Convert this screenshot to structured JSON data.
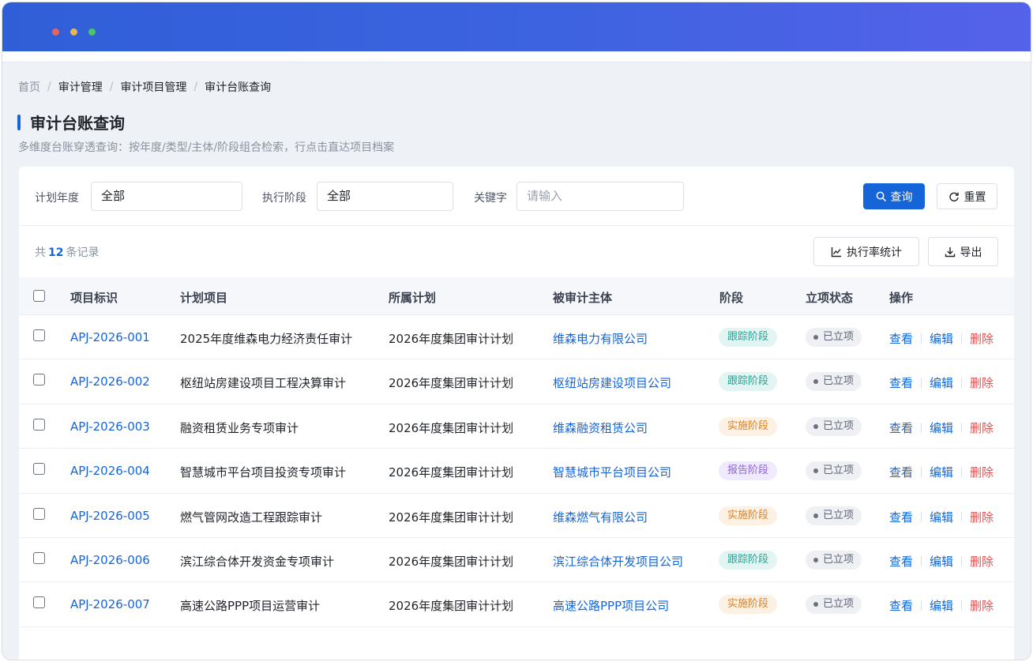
{
  "breadcrumb": [
    "首页",
    "审计管理",
    "审计项目管理",
    "审计台账查询"
  ],
  "page": {
    "title": "审计台账查询",
    "subtitle": "多维度台账穿透查询：按年度/类型/主体/阶段组合检索，行点击直达项目档案"
  },
  "filters": {
    "year_label": "计划年度",
    "year_value": "全部",
    "stage_label": "执行阶段",
    "stage_value": "全部",
    "keyword_label": "关键字",
    "keyword_placeholder": "请输入",
    "query_label": "查询",
    "reset_label": "重置"
  },
  "summary": {
    "prefix": "共",
    "count": "12",
    "suffix": "条记录"
  },
  "toolbar": {
    "stats_label": "执行率统计",
    "export_label": "导出"
  },
  "table": {
    "headers": [
      "项目标识",
      "计划项目",
      "所属计划",
      "被审计主体",
      "阶段",
      "立项状态",
      "操作"
    ],
    "rows": [
      {
        "id": "APJ-2026-001",
        "project": "2025年度维森电力经济责任审计",
        "plan": "2026年度集团审计计划",
        "subject": "维森电力有限公司",
        "stage": "跟踪阶段",
        "stage_type": "track",
        "status": "已立项"
      },
      {
        "id": "APJ-2026-002",
        "project": "枢纽站房建设项目工程决算审计",
        "plan": "2026年度集团审计计划",
        "subject": "枢纽站房建设项目公司",
        "stage": "跟踪阶段",
        "stage_type": "track",
        "status": "已立项"
      },
      {
        "id": "APJ-2026-003",
        "project": "融资租赁业务专项审计",
        "plan": "2026年度集团审计计划",
        "subject": "维森融资租赁公司",
        "stage": "实施阶段",
        "stage_type": "impl",
        "status": "已立项"
      },
      {
        "id": "APJ-2026-004",
        "project": "智慧城市平台项目投资专项审计",
        "plan": "2026年度集团审计计划",
        "subject": "智慧城市平台项目公司",
        "stage": "报告阶段",
        "stage_type": "report",
        "status": "已立项"
      },
      {
        "id": "APJ-2026-005",
        "project": "燃气管网改造工程跟踪审计",
        "plan": "2026年度集团审计计划",
        "subject": "维森燃气有限公司",
        "stage": "实施阶段",
        "stage_type": "impl",
        "status": "已立项"
      },
      {
        "id": "APJ-2026-006",
        "project": "滨江综合体开发资金专项审计",
        "plan": "2026年度集团审计计划",
        "subject": "滨江综合体开发项目公司",
        "stage": "跟踪阶段",
        "stage_type": "track",
        "status": "已立项"
      },
      {
        "id": "APJ-2026-007",
        "project": "高速公路PPP项目运营审计",
        "plan": "2026年度集团审计计划",
        "subject": "高速公路PPP项目公司",
        "stage": "实施阶段",
        "stage_type": "impl",
        "status": "已立项"
      }
    ],
    "actions": {
      "view": "查看",
      "edit": "编辑",
      "delete": "删除"
    }
  },
  "colors": {
    "accent": "#1565d8",
    "danger": "#e05252",
    "titlebar_start": "#2f5fd8",
    "titlebar_end": "#5562ea"
  }
}
